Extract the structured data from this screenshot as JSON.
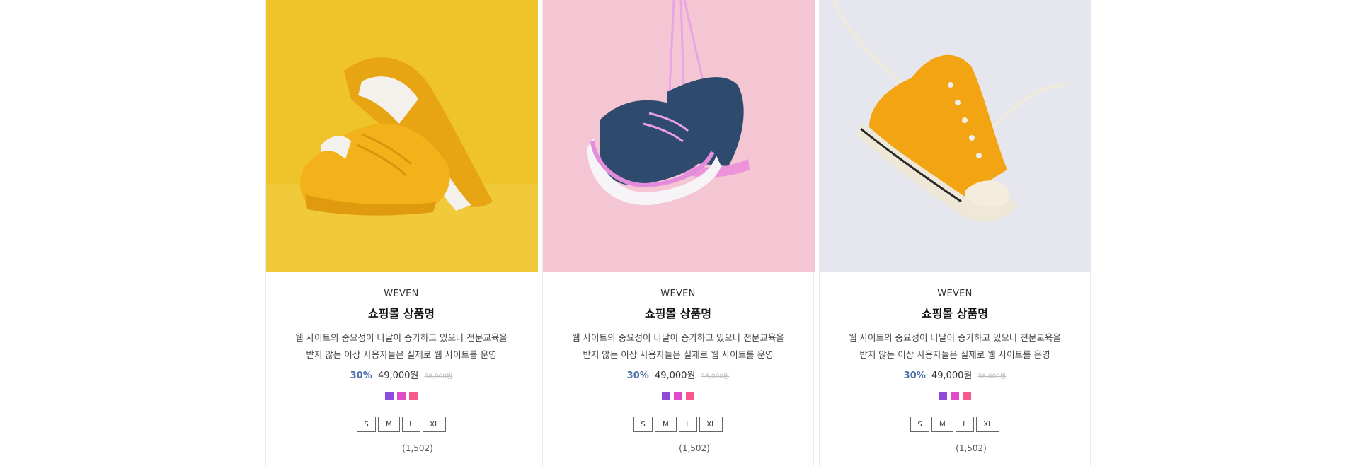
{
  "products": [
    {
      "brand": "WEVEN",
      "name": "쇼핑몰 상품명",
      "description_line1": "웹 사이트의 중요성이 나날이 증가하고 있으나 전문교육을",
      "description_line2": "받지 않는 이상 사용자들은 실제로 웹 사이트를 운영",
      "discount": "30%",
      "sale_price": "49,000원",
      "original_price": "58,000원",
      "colors": [
        "#8d4bd9",
        "#e14bc8",
        "#f5598e"
      ],
      "sizes": [
        "S",
        "M",
        "L",
        "XL"
      ],
      "reviews": "(1,502)",
      "image_bg": "#efc42a",
      "image_subject": "yellow-sneakers"
    },
    {
      "brand": "WEVEN",
      "name": "쇼핑몰 상품명",
      "description_line1": "웹 사이트의 중요성이 나날이 증가하고 있으나 전문교육을",
      "description_line2": "받지 않는 이상 사용자들은 실제로 웹 사이트를 운영",
      "discount": "30%",
      "sale_price": "49,000원",
      "original_price": "58,000원",
      "colors": [
        "#8d4bd9",
        "#e14bc8",
        "#f5598e"
      ],
      "sizes": [
        "S",
        "M",
        "L",
        "XL"
      ],
      "reviews": "(1,502)",
      "image_bg": "#f4c6d4",
      "image_subject": "navy-pink-hanging-sneakers"
    },
    {
      "brand": "WEVEN",
      "name": "쇼핑몰 상품명",
      "description_line1": "웹 사이트의 중요성이 나날이 증가하고 있으나 전문교육을",
      "description_line2": "받지 않는 이상 사용자들은 실제로 웹 사이트를 운영",
      "discount": "30%",
      "sale_price": "49,000원",
      "original_price": "58,000원",
      "colors": [
        "#8d4bd9",
        "#e14bc8",
        "#f5598e"
      ],
      "sizes": [
        "S",
        "M",
        "L",
        "XL"
      ],
      "reviews": "(1,502)",
      "image_bg": "#e6e7ee",
      "image_subject": "orange-high-top-sneaker"
    }
  ]
}
